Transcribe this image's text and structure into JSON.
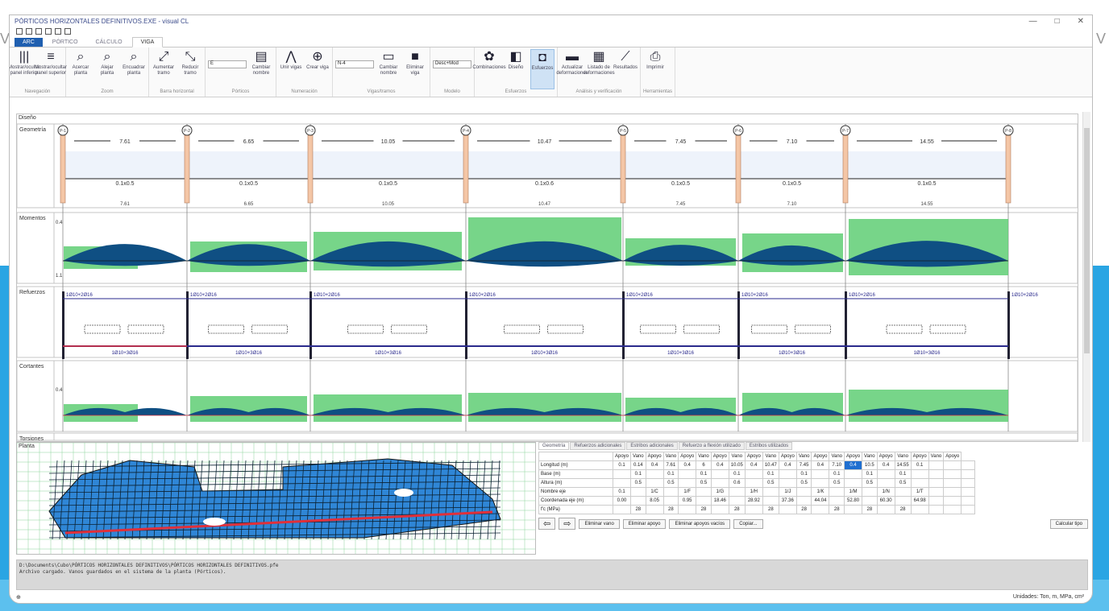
{
  "window": {
    "title": "PÓRTICOS HORIZONTALES DEFINITIVOS.EXE - visual CL",
    "minimize": "—",
    "maximize": "□",
    "close": "✕"
  },
  "tabs": [
    {
      "label": "ARC",
      "type": "file"
    },
    {
      "label": "PÓRTICO",
      "type": "normal"
    },
    {
      "label": "CÁLCULO",
      "type": "normal"
    },
    {
      "label": "VIGA",
      "type": "active"
    }
  ],
  "ribbon": {
    "groups": [
      {
        "label": "Navegación",
        "buttons": [
          {
            "icon": "|||",
            "label": "Mostrar/ocultar panel inferior"
          },
          {
            "icon": "≡",
            "label": "Mostrar/ocultar panel superior"
          }
        ]
      },
      {
        "label": "Zoom",
        "buttons": [
          {
            "icon": "⌕",
            "label": "Acercar planta"
          },
          {
            "icon": "⌕",
            "label": "Alejar planta"
          },
          {
            "icon": "⌕",
            "label": "Encuadrar planta"
          }
        ]
      },
      {
        "label": "Barra horizontal",
        "buttons": [
          {
            "icon": "⤢",
            "label": "Aumentar tramo"
          },
          {
            "icon": "⤡",
            "label": "Reducir tramo"
          }
        ]
      },
      {
        "label": "Pórticos",
        "buttons": [
          {
            "icon": "▤",
            "label": "Cambiar nombre"
          }
        ]
      },
      {
        "label": "Numeración",
        "buttons": [
          {
            "icon": "⋀",
            "label": "Unir vigas"
          },
          {
            "icon": "⊕",
            "label": "Crear viga"
          }
        ]
      },
      {
        "label": "Vigas/tramos",
        "buttons": [
          {
            "icon": "▭",
            "label": "Cambiar nombre"
          },
          {
            "icon": "■",
            "label": "Eliminar viga"
          }
        ]
      },
      {
        "label": "Modelo",
        "buttons": []
      },
      {
        "label": "Esfuerzos",
        "buttons": [
          {
            "icon": "✿",
            "label": "Combinaciones"
          },
          {
            "icon": "◧",
            "label": "Diseño"
          },
          {
            "icon": "◘",
            "label": "Esfuerzos"
          }
        ]
      },
      {
        "label": "Análisis y verificación",
        "buttons": [
          {
            "icon": "▬",
            "label": "Actualizar deformaciones"
          },
          {
            "icon": "▦",
            "label": "Listado de deformaciones"
          },
          {
            "icon": "⟋",
            "label": "Resultados"
          }
        ]
      },
      {
        "label": "Herramientas",
        "buttons": [
          {
            "icon": "⎙",
            "label": "Imprimir"
          }
        ]
      }
    ],
    "combos": [
      "E",
      "N-4",
      "Desc+Mod"
    ]
  },
  "diagram": {
    "label": "Diseño",
    "geometry_label": "Geometría",
    "moments_label": "Momentos",
    "reinforcement_label": "Refuerzos",
    "shear_label": "Cortantes",
    "torsion_label": "Torsiones",
    "supports": [
      "P-1",
      "P-2",
      "P-3",
      "P-4",
      "P-5",
      "P-6",
      "P-7",
      "P-8"
    ],
    "span_lengths": [
      "7.61",
      "6.65",
      "10.05",
      "10.47",
      "7.45",
      "7.10",
      "14.55"
    ],
    "section_labels": [
      "0.1x0.5",
      "0.1x0.5",
      "0.1x0.5",
      "0.1x0.6",
      "0.1x0.5",
      "0.1x0.5",
      "0.1x0.5"
    ],
    "moment_scale": [
      "0.4",
      "1.1"
    ],
    "shear_scale": [
      "0.4"
    ],
    "reinforcement_top": [
      "1Ø10+2Ø16",
      "1Ø10+2Ø16",
      "1Ø10+2Ø16",
      "1Ø10+2Ø16",
      "1Ø10+2Ø16",
      "1Ø10+2Ø16",
      "1Ø10+2Ø16",
      "1Ø10+2Ø16"
    ],
    "reinforcement_bottom": [
      "1Ø10+3Ø16",
      "1Ø10+3Ø16",
      "1Ø10+3Ø16",
      "1Ø10+3Ø16",
      "1Ø10+3Ø16",
      "1Ø10+3Ø16",
      "1Ø10+3Ø16"
    ]
  },
  "plan": {
    "label": "Planta"
  },
  "datatabs": [
    "Geometría",
    "Refuerzos adicionales",
    "Estribos adicionales",
    "Refuerzo a flexión utilizado",
    "Estribos utilizados"
  ],
  "grid": {
    "header": [
      "",
      "Apoyo",
      "Vano",
      "Apoyo",
      "Vano",
      "Apoyo",
      "Vano",
      "Apoyo",
      "Vano",
      "Apoyo",
      "Vano",
      "Apoyo",
      "Vano",
      "Apoyo",
      "Vano",
      "Apoyo",
      "Vano",
      "Apoyo",
      "Vano",
      "Apoyo",
      "Vano",
      "Apoyo"
    ],
    "rows": [
      {
        "label": "Longitud (m)",
        "cells": [
          "0.1",
          "0.14",
          "0.4",
          "7.61",
          "0.4",
          "6",
          "0.4",
          "10.05",
          "0.4",
          "10.47",
          "0.4",
          "7.45",
          "0.4",
          "7.10",
          "0.4",
          "10.5",
          "0.4",
          "14.55",
          "0.1",
          "",
          "",
          ""
        ]
      },
      {
        "label": "Base (m)",
        "cells": [
          "",
          "0.1",
          "",
          "0.1",
          "",
          "0.1",
          "",
          "0.1",
          "",
          "0.1",
          "",
          "0.1",
          "",
          "0.1",
          "",
          "0.1",
          "",
          "0.1",
          "",
          "",
          "",
          ""
        ]
      },
      {
        "label": "Altura (m)",
        "cells": [
          "",
          "0.5",
          "",
          "0.5",
          "",
          "0.5",
          "",
          "0.6",
          "",
          "0.5",
          "",
          "0.5",
          "",
          "0.5",
          "",
          "0.5",
          "",
          "0.5",
          "",
          "",
          "",
          ""
        ]
      },
      {
        "label": "Nombre eje",
        "cells": [
          "0.1",
          "",
          "1/C",
          "",
          "1/F",
          "",
          "1/G",
          "",
          "1/H",
          "",
          "1/J",
          "",
          "1/K",
          "",
          "1/M",
          "",
          "1/N",
          "",
          "1/T",
          "",
          "",
          ""
        ]
      },
      {
        "label": "Coordenada eje (m)",
        "cells": [
          "0.00",
          "",
          "8.05",
          "",
          "0.95",
          "",
          "18.46",
          "",
          "28.92",
          "",
          "37.36",
          "",
          "44.04",
          "",
          "52.80",
          "",
          "60.30",
          "",
          "64.98",
          "",
          "",
          ""
        ]
      },
      {
        "label": "f'c (MPa)",
        "cells": [
          "",
          "28",
          "",
          "28",
          "",
          "28",
          "",
          "28",
          "",
          "28",
          "",
          "28",
          "",
          "28",
          "",
          "28",
          "",
          "28",
          "",
          "",
          "",
          ""
        ]
      }
    ]
  },
  "actions": {
    "prev": "⇦",
    "next": "⇨",
    "delete_span": "Eliminar vano",
    "delete_support": "Eliminar apoyo",
    "delete_supports_all": "Eliminar apoyos vacíos",
    "copy": "Copiar...",
    "calc": "Calcular tipo"
  },
  "console": {
    "line1": "D:\\Documents\\Cubo\\PÓRTICOS HORIZONTALES DEFINITIVOS\\PÓRTICOS HORIZONTALES DEFINITIVOS.pfe",
    "line2": "Archivo cargado. Vanos guardados en el sistema de la planta (Pórticos)."
  },
  "status": {
    "left": "⊕",
    "right": "Unidades: Ton, m, MPa, cm²"
  },
  "colors": {
    "accent": "#1f5fb0",
    "envelope": "#5fce74",
    "diagram": "#0f4f83",
    "support": "#f4c6a6",
    "reinforce": "#2a2a8c",
    "redline": "#e0303a"
  }
}
